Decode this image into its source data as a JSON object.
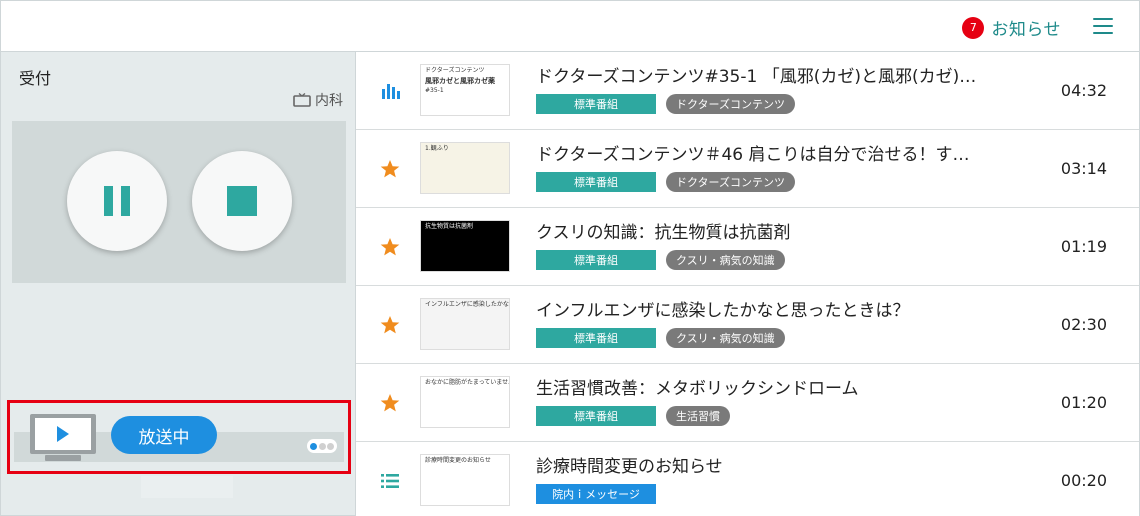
{
  "header": {
    "notice_count": "7",
    "notice_label": "お知らせ"
  },
  "left": {
    "room": "受付",
    "department": "内科",
    "onair_label": "放送中"
  },
  "items": [
    {
      "icon": "equalizer-icon",
      "title": "ドクターズコンテンツ#35-1 「風邪(カゼ)と風邪(カゼ)…",
      "tags": [
        {
          "label": "標準番組",
          "style": "teal"
        },
        {
          "label": "ドクターズコンテンツ",
          "style": "gray"
        }
      ],
      "duration": "04:32",
      "thumb_text": [
        "ドクターズコンテンツ",
        "風邪カゼと風邪カゼ薬",
        "#35-1"
      ]
    },
    {
      "icon": "star-icon",
      "title": "ドクターズコンテンツ＃46 肩こりは自分で治せる！す…",
      "tags": [
        {
          "label": "標準番組",
          "style": "teal"
        },
        {
          "label": "ドクターズコンテンツ",
          "style": "gray"
        }
      ],
      "duration": "03:14",
      "thumb_text": [
        "1.観ふり"
      ]
    },
    {
      "icon": "star-icon",
      "title": "クスリの知識：抗生物質は抗菌剤",
      "tags": [
        {
          "label": "標準番組",
          "style": "teal"
        },
        {
          "label": "クスリ・病気の知識",
          "style": "gray"
        }
      ],
      "duration": "01:19",
      "thumb_text": [
        "抗生物質は抗菌剤"
      ]
    },
    {
      "icon": "star-icon",
      "title": "インフルエンザに感染したかなと思ったときは？",
      "tags": [
        {
          "label": "標準番組",
          "style": "teal"
        },
        {
          "label": "クスリ・病気の知識",
          "style": "gray"
        }
      ],
      "duration": "02:30",
      "thumb_text": [
        "インフルエンザに感染したかなと思ったときは"
      ]
    },
    {
      "icon": "star-icon",
      "title": "生活習慣改善：メタボリックシンドローム",
      "tags": [
        {
          "label": "標準番組",
          "style": "teal"
        },
        {
          "label": "生活習慣",
          "style": "gray"
        }
      ],
      "duration": "01:20",
      "thumb_text": [
        "おなかに脂肪がたまっていませんか？"
      ]
    },
    {
      "icon": "list-icon",
      "title": "診療時間変更のお知らせ",
      "tags": [
        {
          "label": "院内ｉメッセージ",
          "style": "blue"
        }
      ],
      "duration": "00:20",
      "thumb_text": [
        "診療時間変更のお知らせ"
      ]
    }
  ],
  "colors": {
    "accent_teal": "#2ea8a0",
    "accent_blue": "#1e8fe0",
    "alert_red": "#e60012",
    "star_orange": "#f08c1e"
  }
}
